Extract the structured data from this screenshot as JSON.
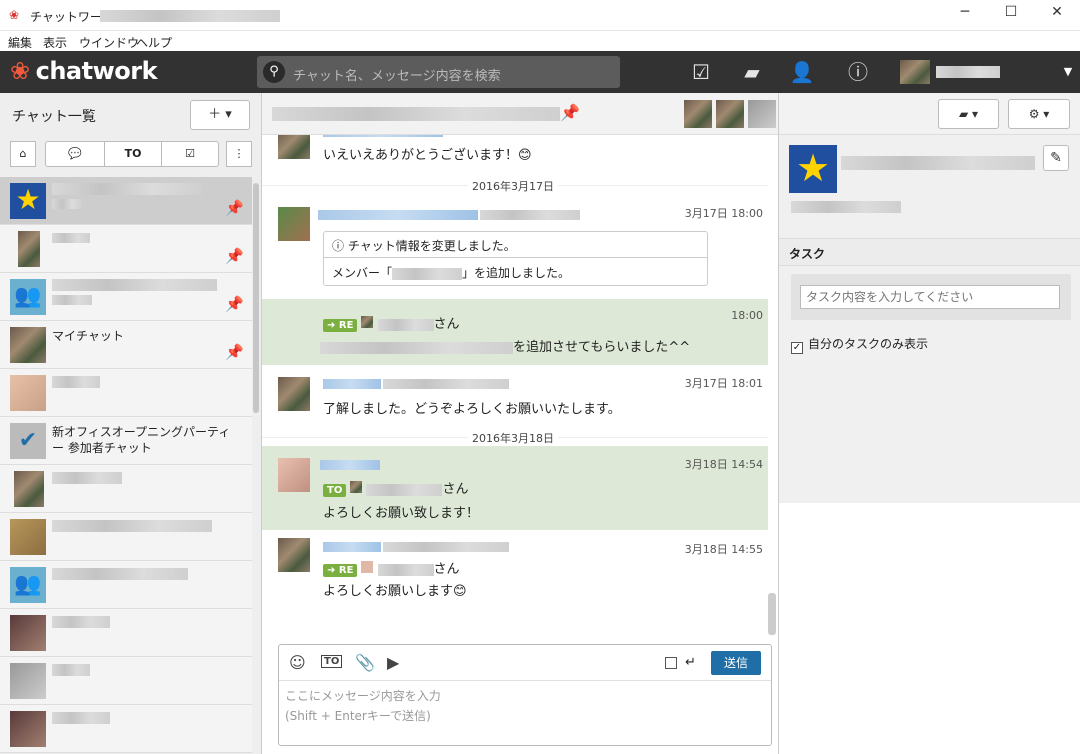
{
  "window": {
    "title": "チャットワーク -",
    "minimize": "─",
    "maximize": "☐",
    "close": "✕"
  },
  "menu": [
    "編集",
    "表示",
    "ウインドウ",
    "ヘルプ"
  ],
  "brand": "chatwork",
  "search": {
    "placeholder": "チャット名、メッセージ内容を検索"
  },
  "sidebar": {
    "title": "チャット一覧",
    "add_button": "＋ ▾",
    "filters": [
      "⌂",
      "💬",
      "TO",
      "☑",
      "⋮"
    ],
    "rooms": [
      {
        "name": "",
        "pinned": true,
        "selected": true
      },
      {
        "name": "",
        "pinned": true
      },
      {
        "name": "",
        "pinned": true
      },
      {
        "name": "マイチャット",
        "pinned": true
      },
      {
        "name": ""
      },
      {
        "name": "新オフィスオープニングパーティー 参加者チャット"
      },
      {
        "name": ""
      },
      {
        "name": ""
      },
      {
        "name": ""
      },
      {
        "name": ""
      },
      {
        "name": ""
      },
      {
        "name": ""
      }
    ]
  },
  "room": {
    "member_count": "+3",
    "add_member": "+"
  },
  "messages": [
    {
      "time": "",
      "text": "いえいえありがとうございます！😊"
    },
    {
      "day": "2016年3月17日"
    },
    {
      "time": "3月17日 18:00",
      "info_header": "チャット情報を変更しました。",
      "info_body_pre": "メンバー「",
      "info_body_post": "」を追加しました。"
    },
    {
      "time": "18:00",
      "tag": "RE",
      "suffix": "さん",
      "text": "を追加させてもらいました^^"
    },
    {
      "time": "3月17日 18:01",
      "text": "了解しました。どうぞよろしくお願いいたします。"
    },
    {
      "day": "2016年3月18日"
    },
    {
      "time": "3月18日 14:54",
      "tag": "TO",
      "suffix": "さん",
      "text": "よろしくお願い致します！"
    },
    {
      "time": "3月18日 14:55",
      "tag": "RE",
      "suffix": "さん",
      "text": "よろしくお願いします😊"
    }
  ],
  "composer": {
    "send": "送信",
    "enter_icon": "↵",
    "placeholder_1": "ここにメッセージ内容を入力",
    "placeholder_2": "(Shift + Enterキーで送信)",
    "tool_to": "TO"
  },
  "right": {
    "task_header": "タスク",
    "task_placeholder": "タスク内容を入力してください",
    "only_mine": "自分のタスクのみ表示",
    "only_mine_checked": "✓"
  },
  "colors": {
    "topbar": "#323232",
    "accent": "#1f6fa6",
    "highlight": "#dde9d6",
    "tag": "#7bb041",
    "pin": "#1f6fb0",
    "brand_mark": "#f35a3c"
  }
}
